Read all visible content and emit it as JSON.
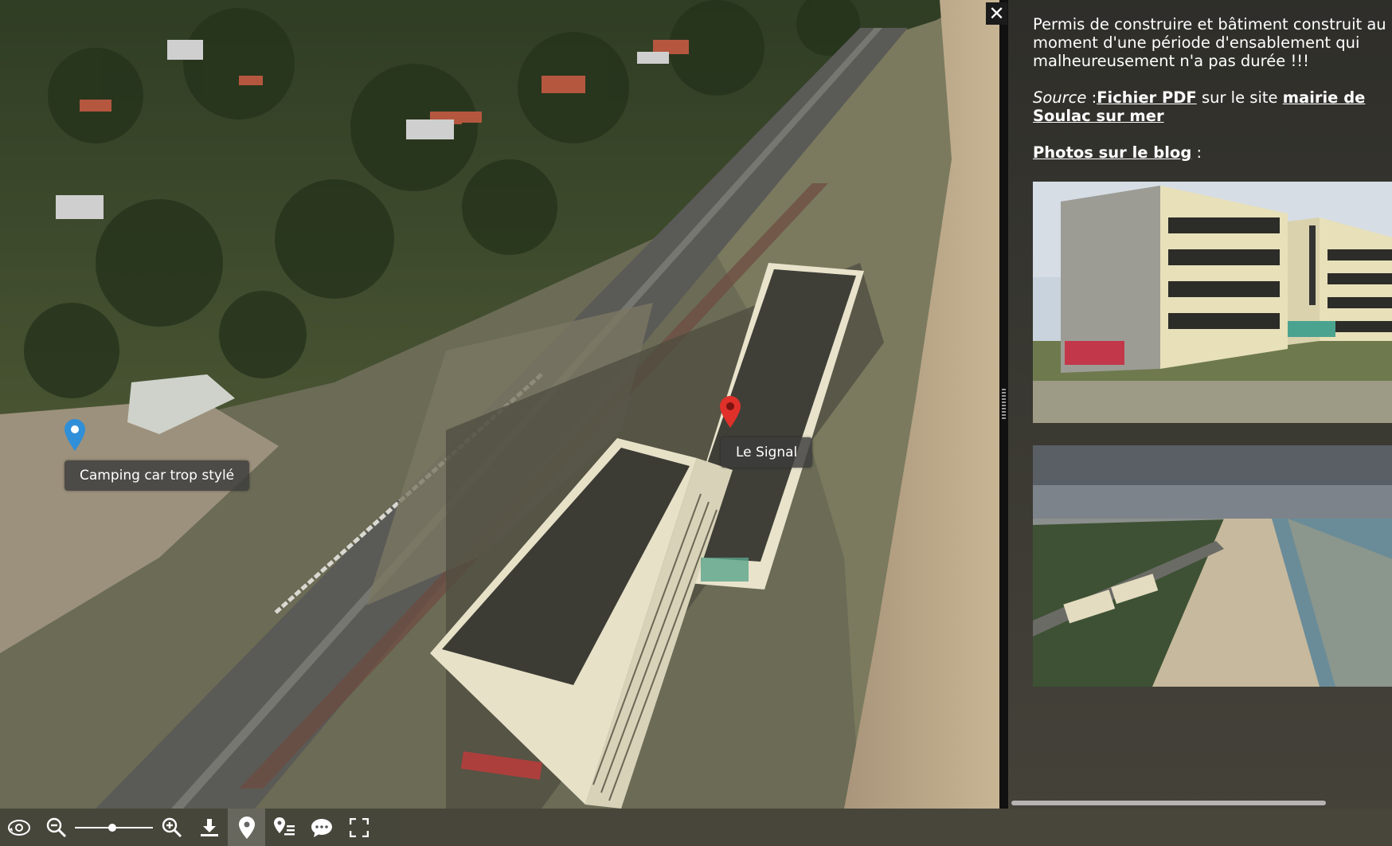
{
  "viewer": {
    "markers": [
      {
        "label": "Camping car trop stylé",
        "color": "#2f8fd8",
        "icon": "map-marker-icon"
      },
      {
        "label": "Le Signal",
        "color": "#e0302a",
        "icon": "map-marker-icon"
      }
    ]
  },
  "side_panel": {
    "close_icon": "close-icon",
    "description": "Permis de construire et bâtiment construit au moment d'une période d'ensablement qui malheureusement n'a pas durée !!!",
    "source_label": "Source",
    "source_sep": " :",
    "source_link": "Fichier PDF",
    "source_middle": " sur le site ",
    "mairie_link": "mairie de Soulac sur mer",
    "photos_link": "Photos sur le blog",
    "photos_suffix": " :",
    "photos": [
      {
        "description_icon": "photo-building-closeup"
      },
      {
        "description_icon": "photo-aerial-beach"
      }
    ]
  },
  "navbar": {
    "buttons": [
      {
        "icon": "autorotate-icon"
      },
      {
        "icon": "zoom-out-icon"
      },
      {
        "icon": "zoom-in-icon"
      },
      {
        "icon": "download-icon"
      },
      {
        "icon": "markers-icon",
        "active": true
      },
      {
        "icon": "markers-list-icon"
      },
      {
        "icon": "caption-icon"
      },
      {
        "icon": "fullscreen-icon"
      }
    ],
    "zoom_level": 0.48
  },
  "colors": {
    "panel_bg": "#2a2a27",
    "marker_blue": "#2f8fd8",
    "marker_red": "#e0302a"
  }
}
